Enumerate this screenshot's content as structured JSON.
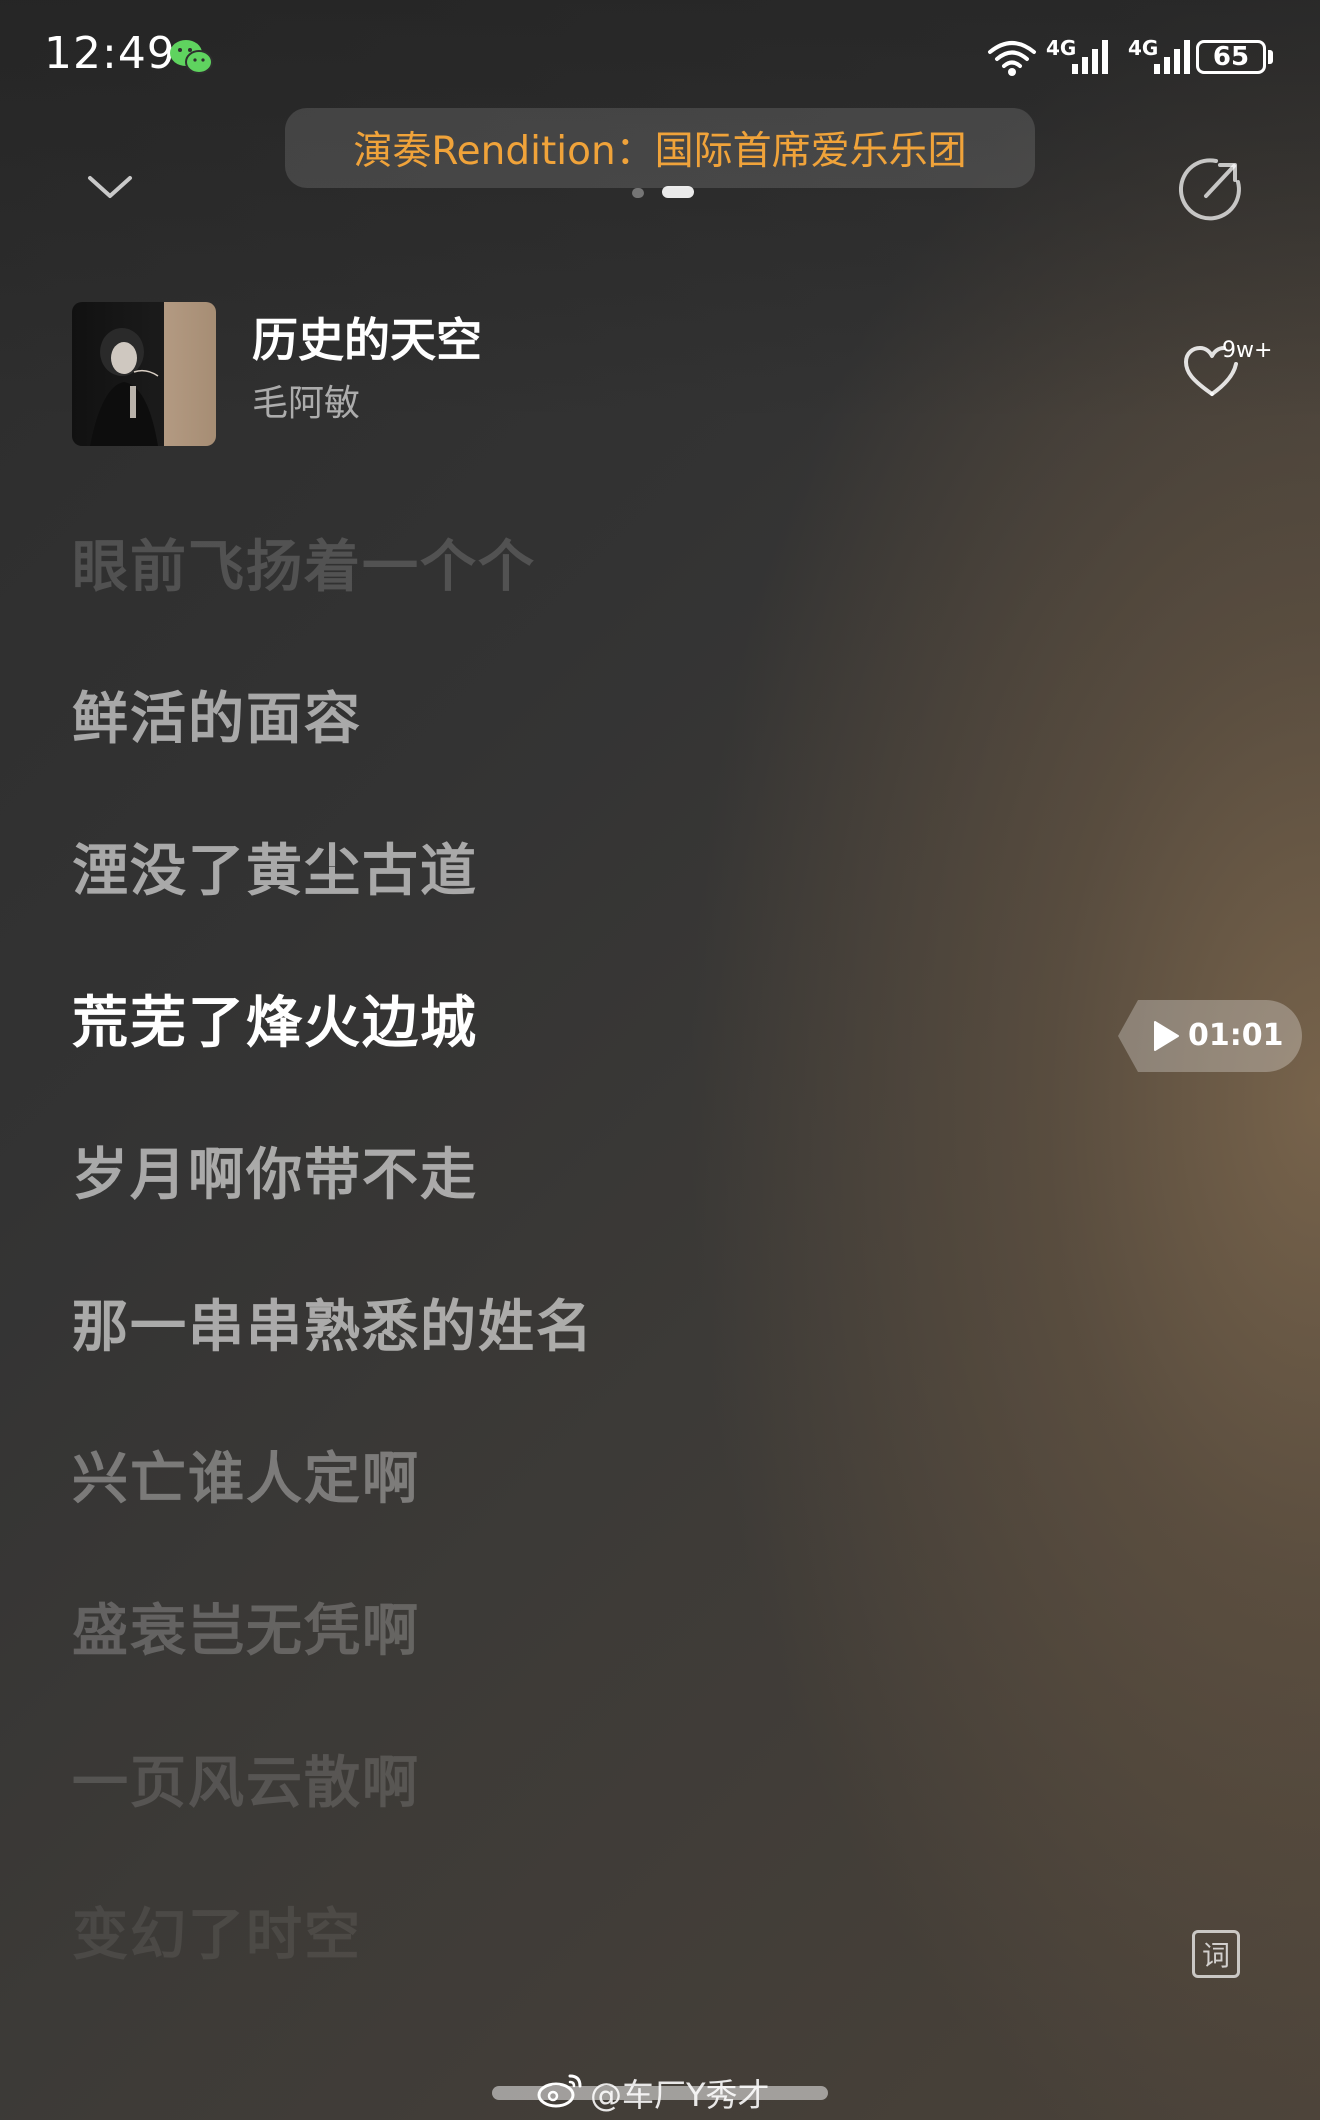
{
  "status_bar": {
    "time": "12:49",
    "network_1": "4G",
    "network_2": "4G",
    "battery": "65",
    "icons": [
      "wechat-icon",
      "wifi-icon",
      "signal-icon",
      "signal-icon",
      "battery-icon"
    ]
  },
  "header": {
    "rendition": "演奏Rendition：国际首席爱乐乐团",
    "icons": [
      "chevron-down-icon",
      "share-icon"
    ]
  },
  "song": {
    "title": "历史的天空",
    "artist": "毛阿敏",
    "like_count": "9w+"
  },
  "lyrics": [
    "眼前飞扬着一个个",
    "鲜活的面容",
    "湮没了黄尘古道",
    "荒芜了烽火边城",
    "岁月啊你带不走",
    "那一串串熟悉的姓名",
    "兴亡谁人定啊",
    "盛衰岂无凭啊",
    "一页风云散啊",
    "变幻了时空"
  ],
  "active_lyric_index": 3,
  "seek": {
    "time": "01:01"
  },
  "lyric_mode_label": "词",
  "watermark": "@车厂Y秀才",
  "colors": {
    "accent": "#f0a33a",
    "text_primary": "#ffffff"
  }
}
